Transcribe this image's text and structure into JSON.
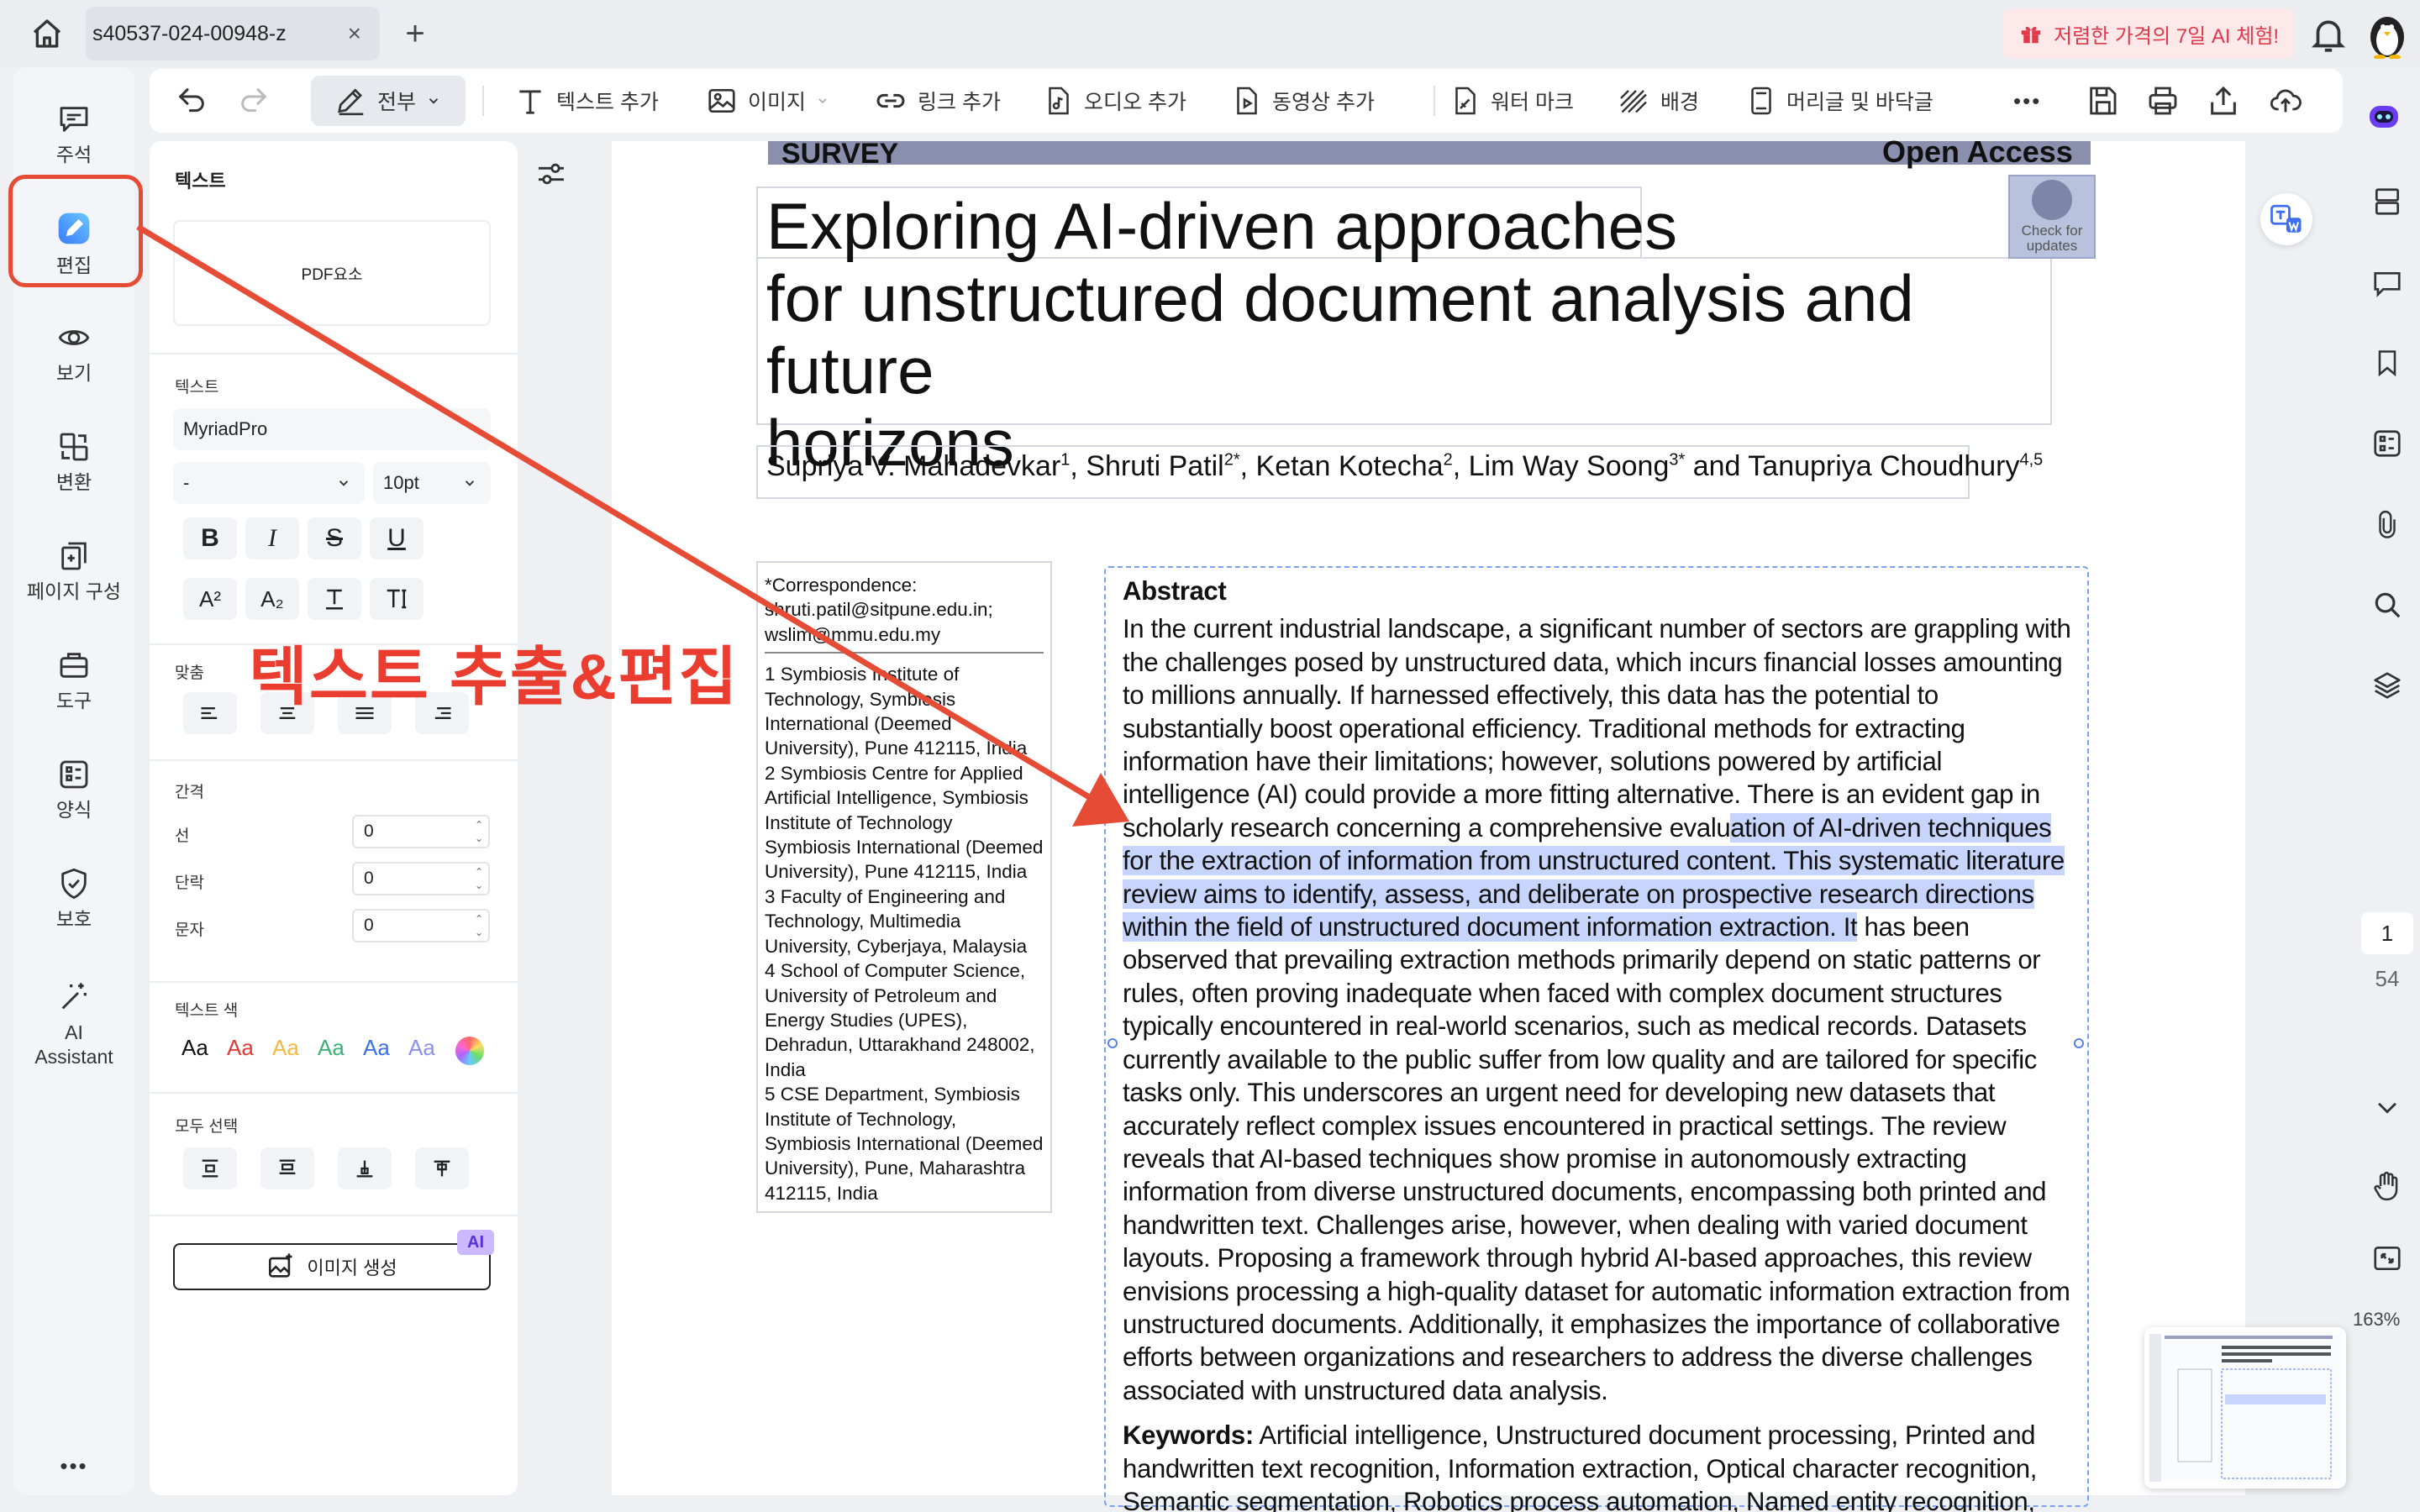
{
  "titlebar": {
    "tab_title": "s40537-024-00948-z",
    "tab_close": "×",
    "new_tab": "+",
    "promo": "저렴한 가격의 7일 AI 체험!"
  },
  "leftnav": {
    "items": [
      {
        "label": "주석",
        "icon": "comment-icon"
      },
      {
        "label": "편집",
        "icon": "edit-pen-icon"
      },
      {
        "label": "보기",
        "icon": "eye-icon"
      },
      {
        "label": "변환",
        "icon": "convert-icon"
      },
      {
        "label": "페이지 구성",
        "icon": "pages-icon"
      },
      {
        "label": "도구",
        "icon": "toolbox-icon"
      },
      {
        "label": "양식",
        "icon": "form-icon"
      },
      {
        "label": "보호",
        "icon": "shield-icon"
      },
      {
        "label": "AI\nAssistant",
        "icon": "magic-wand-icon"
      }
    ],
    "more": "•••"
  },
  "toolbar": {
    "all_label": "전부",
    "add_text": "텍스트 추가",
    "image": "이미지",
    "add_link": "링크 추가",
    "add_audio": "오디오 추가",
    "add_video": "동영상 추가",
    "watermark": "워터 마크",
    "background": "배경",
    "header_footer": "머리글 및 바닥글",
    "more": "•••"
  },
  "panel": {
    "title": "텍스트",
    "element_box": "PDF요소",
    "font_section": "텍스트",
    "font_name": "MyriadPro",
    "font_style": "-",
    "font_size": "10pt",
    "align_label": "맞춤",
    "spacing_label": "간격",
    "line_label": "선",
    "line_value": "0",
    "paragraph_label": "단락",
    "paragraph_value": "0",
    "char_label": "문자",
    "char_value": "0",
    "color_label": "텍스트 색",
    "color_samples": [
      {
        "text": "Aa",
        "color": "#111111"
      },
      {
        "text": "Aa",
        "color": "#e53935"
      },
      {
        "text": "Aa",
        "color": "#f5b942"
      },
      {
        "text": "Aa",
        "color": "#3bb273"
      },
      {
        "text": "Aa",
        "color": "#3b6ff0"
      },
      {
        "text": "Aa",
        "color": "#8c8ff2"
      }
    ],
    "select_all_label": "모두 선택",
    "image_gen": "이미지 생성",
    "ai_badge": "AI"
  },
  "annotation": {
    "text": "텍스트 추출&편집",
    "color": "#ea3d2f"
  },
  "document": {
    "band_left": "SURVEY",
    "band_right": "Open Access",
    "check_updates": "Check for\nupdates",
    "title_lines": [
      "Exploring AI-driven approaches",
      "for unstructured document analysis and future",
      "horizons"
    ],
    "authors": [
      {
        "name": "Supriya V. Mahadevkar",
        "sup": "1",
        "sep": ", "
      },
      {
        "name": "Shruti Patil",
        "sup": "2*",
        "sep": ", "
      },
      {
        "name": "Ketan Kotecha",
        "sup": "2",
        "sep": ", "
      },
      {
        "name": "Lim Way Soong",
        "sup": "3*",
        "sep": " and "
      },
      {
        "name": "Tanupriya Choudhury",
        "sup": "4,5",
        "sep": ""
      }
    ],
    "correspondence": "*Correspondence:\nshruti.patil@sitpune.edu.in;\nwslim@mmu.edu.my",
    "affiliations": [
      "1 Symbiosis Institute of Technology, Symbiosis International (Deemed University), Pune 412115, India",
      "2 Symbiosis Centre for Applied Artificial Intelligence, Symbiosis Institute of Technology Symbiosis International (Deemed University), Pune 412115, India",
      "3 Faculty of Engineering and Technology, Multimedia University, Cyberjaya, Malaysia",
      "4 School of Computer Science, University of Petroleum and Energy Studies (UPES), Dehradun, Uttarakhand 248002, India",
      "5 CSE Department, Symbiosis Institute of Technology, Symbiosis International (Deemed University), Pune, Maharashtra 412115, India"
    ],
    "abstract_title": "Abstract",
    "abstract_before": "In the current industrial landscape, a significant number of sectors are grappling with the challenges posed by unstructured data, which incurs financial losses amounting to millions annually. If harnessed effectively, this data has the potential to substantially boost operational efficiency. Traditional methods for extracting information have their limitations; however, solutions powered by artificial intelligence (AI) could provide a more fitting alternative. There is an evident gap in scholarly research concerning a comprehensive evalu",
    "abstract_highlight": "ation of AI-driven techniques for the extraction of information from unstructured content. This systematic literature review aims to identify, assess, and deliberate on prospective research directions within the field of unstructured document information extraction. It",
    "abstract_after": " has been observed that prevailing extraction methods primarily depend on static patterns or rules, often proving inadequate when faced with complex document structures typically encountered in real-world scenarios, such as medical records. Datasets currently available to the public suffer from low quality and are tailored for specific tasks only. This underscores an urgent need for developing new datasets that accurately reflect complex issues encountered in practical settings. The review reveals that AI-based techniques show promise in autonomously extracting information from diverse unstructured documents, encompassing both printed and handwritten text. Challenges arise, however, when dealing with varied document layouts. Proposing a framework through hybrid AI-based approaches, this review envisions processing a high-quality dataset for automatic information extraction from unstructured documents. Additionally, it emphasizes the importance of collaborative efforts between organizations and researchers to address the diverse challenges associated with unstructured data analysis.",
    "keywords_label": "Keywords:",
    "keywords": "Artificial intelligence, Unstructured document processing, Printed and handwritten text recognition, Information extraction, Optical character recognition, Semantic segmentation, Robotics process automation, Named entity recognition, Large Language models"
  },
  "pager": {
    "current": "1",
    "total": "54",
    "zoom": "163%"
  }
}
